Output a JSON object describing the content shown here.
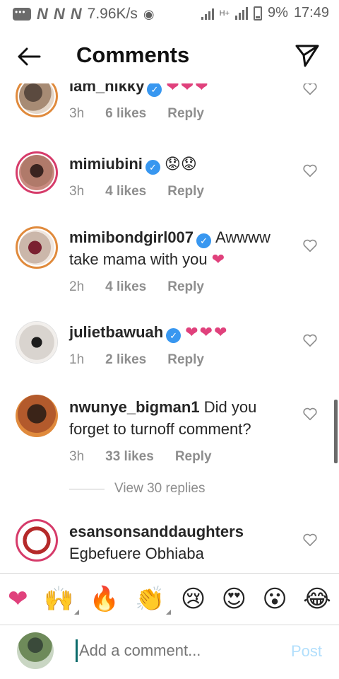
{
  "status_bar": {
    "network_marks": [
      "N",
      "N",
      "N"
    ],
    "speed": "7.96K/s",
    "signal_type": "H+",
    "battery": "9%",
    "time": "17:49"
  },
  "header": {
    "title": "Comments"
  },
  "comments": [
    {
      "username": "iam_nikky",
      "verified": true,
      "text": "❤❤❤",
      "time": "3h",
      "likes": "6 likes",
      "reply": "Reply"
    },
    {
      "username": "mimiubini",
      "verified": true,
      "text": "😟😟",
      "time": "3h",
      "likes": "4 likes",
      "reply": "Reply"
    },
    {
      "username": "mimibondgirl007",
      "verified": true,
      "text": "Awwww take mama with you",
      "emoji": "❤",
      "time": "2h",
      "likes": "4 likes",
      "reply": "Reply"
    },
    {
      "username": "julietbawuah",
      "verified": true,
      "text": "❤❤❤",
      "time": "1h",
      "likes": "2 likes",
      "reply": "Reply"
    },
    {
      "username": "nwunye_bigman1",
      "verified": false,
      "text": "Did you forget to turnoff comment?",
      "time": "3h",
      "likes": "33 likes",
      "reply": "Reply"
    },
    {
      "username": "esansonsanddaughters",
      "verified": false,
      "text": "Egbefuere Obhiaba",
      "time": "",
      "likes": "",
      "reply": ""
    }
  ],
  "view_replies": "View 30 replies",
  "emoji_bar": [
    "❤",
    "🙌",
    "🔥",
    "👏",
    "😢",
    "😍",
    "😮",
    "😂"
  ],
  "composer": {
    "placeholder": "Add a comment...",
    "post_label": "Post"
  },
  "colors": {
    "accent": "#3897f0",
    "heart": "#e0417c",
    "post_disabled": "#b2dffc",
    "meta": "#8e8e8e"
  }
}
